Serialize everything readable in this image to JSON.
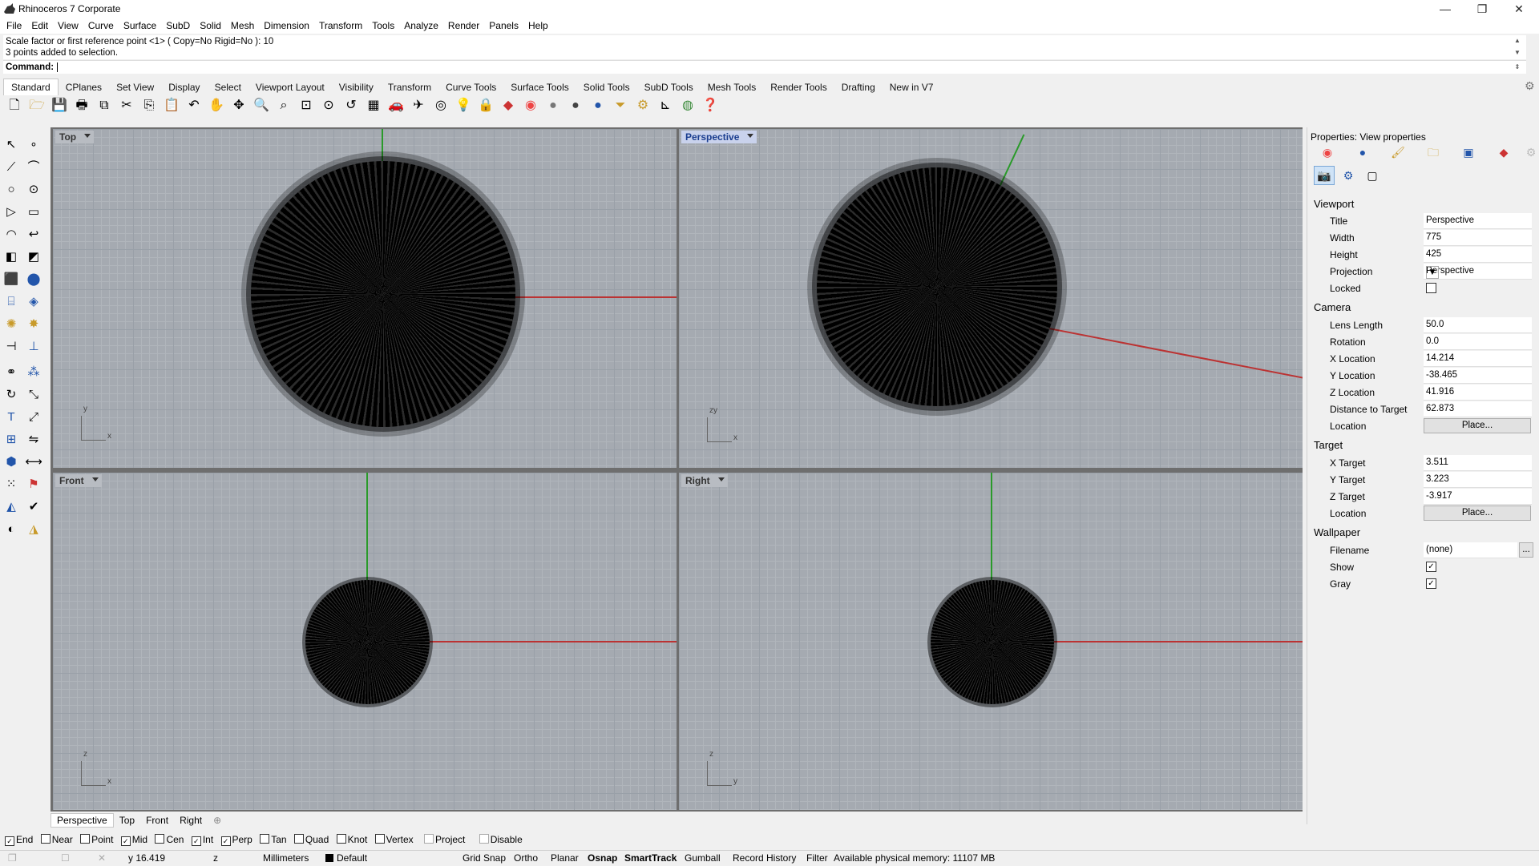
{
  "window": {
    "title": "Rhinoceros 7 Corporate",
    "min_symbol": "—",
    "max_symbol": "❐",
    "close_symbol": "✕"
  },
  "menu": [
    "File",
    "Edit",
    "View",
    "Curve",
    "Surface",
    "SubD",
    "Solid",
    "Mesh",
    "Dimension",
    "Transform",
    "Tools",
    "Analyze",
    "Render",
    "Panels",
    "Help"
  ],
  "command": {
    "history": [
      "Scale factor or first reference point <1> ( Copy=No  Rigid=No ): 10",
      "3 points added to selection."
    ],
    "prompt": "Command:"
  },
  "toolbar_tabs": [
    "Standard",
    "CPlanes",
    "Set View",
    "Display",
    "Select",
    "Viewport Layout",
    "Visibility",
    "Transform",
    "Curve Tools",
    "Surface Tools",
    "Solid Tools",
    "SubD Tools",
    "Mesh Tools",
    "Render Tools",
    "Drafting",
    "New in V7"
  ],
  "toolbar_icons": [
    "new-file",
    "open-file",
    "save",
    "print",
    "import",
    "cut",
    "copy",
    "paste",
    "undo",
    "pan",
    "rotate-view",
    "zoom",
    "zoom-window",
    "zoom-extents",
    "zoom-selected",
    "undo-view",
    "grid",
    "car",
    "plane",
    "circle-tool",
    "light-bulb",
    "lock",
    "layer",
    "color-wheel",
    "sphere-gray",
    "sphere-dark",
    "sphere-blue",
    "filter",
    "gear",
    "dimension",
    "render",
    "help"
  ],
  "viewports": [
    {
      "label": "Top",
      "axis1": "y",
      "axis2": "x"
    },
    {
      "label": "Perspective",
      "axis1": "zy",
      "axis2": "x"
    },
    {
      "label": "Front",
      "axis1": "z",
      "axis2": "x"
    },
    {
      "label": "Right",
      "axis1": "z",
      "axis2": "y"
    }
  ],
  "view_tabs": [
    "Perspective",
    "Top",
    "Front",
    "Right",
    "⊕"
  ],
  "osnap": [
    {
      "label": "End",
      "checked": true
    },
    {
      "label": "Near",
      "checked": false
    },
    {
      "label": "Point",
      "checked": false
    },
    {
      "label": "Mid",
      "checked": true
    },
    {
      "label": "Cen",
      "checked": false
    },
    {
      "label": "Int",
      "checked": true
    },
    {
      "label": "Perp",
      "checked": true
    },
    {
      "label": "Tan",
      "checked": false
    },
    {
      "label": "Quad",
      "checked": false
    },
    {
      "label": "Knot",
      "checked": false
    },
    {
      "label": "Vertex",
      "checked": false
    },
    {
      "label": "Project",
      "checked": false
    },
    {
      "label": "Disable",
      "checked": false
    }
  ],
  "status": {
    "y": "y 16.419",
    "z": "z",
    "units": "Millimeters",
    "layer": "Default",
    "grid_snap": "Grid Snap",
    "ortho": "Ortho",
    "planar": "Planar",
    "osnap": "Osnap",
    "smarttrack": "SmartTrack",
    "gumball": "Gumball",
    "record_history": "Record History",
    "filter": "Filter",
    "memory": "Available physical memory: 11107 MB"
  },
  "properties": {
    "title": "Properties: View properties",
    "sections": {
      "viewport": "Viewport",
      "camera": "Camera",
      "target": "Target",
      "wallpaper": "Wallpaper"
    },
    "viewport": {
      "title_label": "Title",
      "title": "Perspective",
      "width_label": "Width",
      "width": "775",
      "height_label": "Height",
      "height": "425",
      "projection_label": "Projection",
      "projection": "Perspective",
      "locked_label": "Locked",
      "locked": false
    },
    "camera": {
      "lens_label": "Lens Length",
      "lens": "50.0",
      "rotation_label": "Rotation",
      "rotation": "0.0",
      "xloc_label": "X Location",
      "xloc": "14.214",
      "yloc_label": "Y Location",
      "yloc": "-38.465",
      "zloc_label": "Z Location",
      "zloc": "41.916",
      "dist_label": "Distance to Target",
      "dist": "62.873",
      "location_label": "Location",
      "place": "Place..."
    },
    "target": {
      "xt_label": "X Target",
      "xt": "3.511",
      "yt_label": "Y Target",
      "yt": "3.223",
      "zt_label": "Z Target",
      "zt": "-3.917",
      "location_label": "Location",
      "place": "Place..."
    },
    "wallpaper": {
      "filename_label": "Filename",
      "filename": "(none)",
      "browse": "...",
      "show_label": "Show",
      "show": true,
      "gray_label": "Gray",
      "gray": true
    }
  }
}
